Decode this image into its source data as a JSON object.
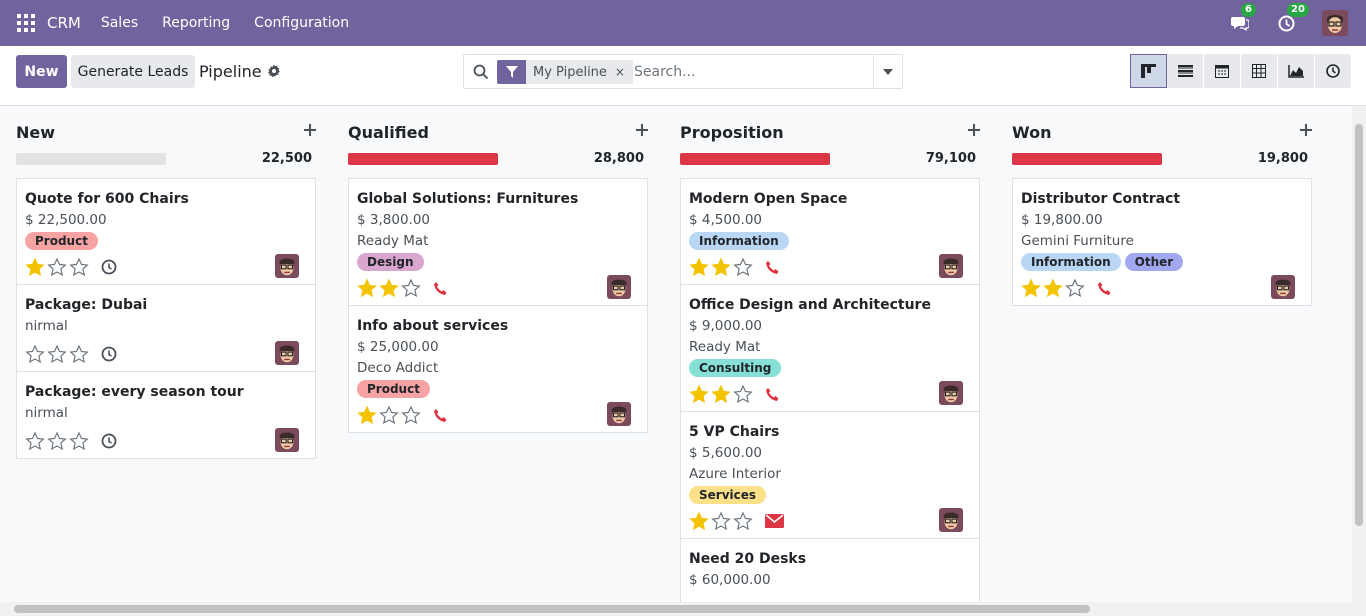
{
  "navbar": {
    "brand": "CRM",
    "menus": [
      "Sales",
      "Reporting",
      "Configuration"
    ],
    "messages_count": "6",
    "activities_count": "20"
  },
  "control_panel": {
    "new_label": "New",
    "generate_label": "Generate Leads",
    "breadcrumb": "Pipeline",
    "facet_label": "My Pipeline",
    "facet_close": "×",
    "search_placeholder": "Search...",
    "views": [
      "kanban",
      "list",
      "calendar",
      "pivot",
      "graph",
      "activity"
    ],
    "active_view": "kanban"
  },
  "colors": {
    "brand": "#71639e",
    "progress_red": "#dc3545",
    "progress_empty": "#e2e3e5",
    "star_on": "#f3c300",
    "star_off": "#6c757d",
    "phone": "#dc3545"
  },
  "columns": [
    {
      "title": "New",
      "total": "22,500",
      "progress": "empty",
      "cards": [
        {
          "title": "Quote for 600 Chairs",
          "amount": "$ 22,500.00",
          "company": "",
          "tags": [
            {
              "label": "Product",
              "color": "#f8a3a3"
            }
          ],
          "stars": 1,
          "activity": "clock"
        },
        {
          "title": "Package: Dubai",
          "amount": "",
          "company": "nirmal",
          "tags": [],
          "stars": 0,
          "activity": "clock"
        },
        {
          "title": "Package: every season tour",
          "amount": "",
          "company": "nirmal",
          "tags": [],
          "stars": 0,
          "activity": "clock"
        }
      ]
    },
    {
      "title": "Qualified",
      "total": "28,800",
      "progress": "red",
      "cards": [
        {
          "title": "Global Solutions: Furnitures",
          "amount": "$ 3,800.00",
          "company": "Ready Mat",
          "tags": [
            {
              "label": "Design",
              "color": "#d9a6d0"
            }
          ],
          "stars": 2,
          "activity": "phone"
        },
        {
          "title": "Info about services",
          "amount": "$ 25,000.00",
          "company": "Deco Addict",
          "tags": [
            {
              "label": "Product",
              "color": "#f8a3a3"
            }
          ],
          "stars": 1,
          "activity": "phone"
        }
      ]
    },
    {
      "title": "Proposition",
      "total": "79,100",
      "progress": "red",
      "cards": [
        {
          "title": "Modern Open Space",
          "amount": "$ 4,500.00",
          "company": "",
          "tags": [
            {
              "label": "Information",
              "color": "#b9d6f5"
            }
          ],
          "stars": 2,
          "activity": "phone"
        },
        {
          "title": "Office Design and Architecture",
          "amount": "$ 9,000.00",
          "company": "Ready Mat",
          "tags": [
            {
              "label": "Consulting",
              "color": "#86e0d6"
            }
          ],
          "stars": 2,
          "activity": "phone"
        },
        {
          "title": "5 VP Chairs",
          "amount": "$ 5,600.00",
          "company": "Azure Interior",
          "tags": [
            {
              "label": "Services",
              "color": "#fce08a"
            }
          ],
          "stars": 1,
          "activity": "email"
        },
        {
          "title": "Need 20 Desks",
          "amount": "$ 60,000.00",
          "company": "",
          "tags": [],
          "stars": 0,
          "activity": ""
        }
      ]
    },
    {
      "title": "Won",
      "total": "19,800",
      "progress": "red",
      "cards": [
        {
          "title": "Distributor Contract",
          "amount": "$ 19,800.00",
          "company": "Gemini Furniture",
          "tags": [
            {
              "label": "Information",
              "color": "#b9d6f5"
            },
            {
              "label": "Other",
              "color": "#a1a8f0"
            }
          ],
          "stars": 2,
          "activity": "phone"
        }
      ]
    }
  ]
}
